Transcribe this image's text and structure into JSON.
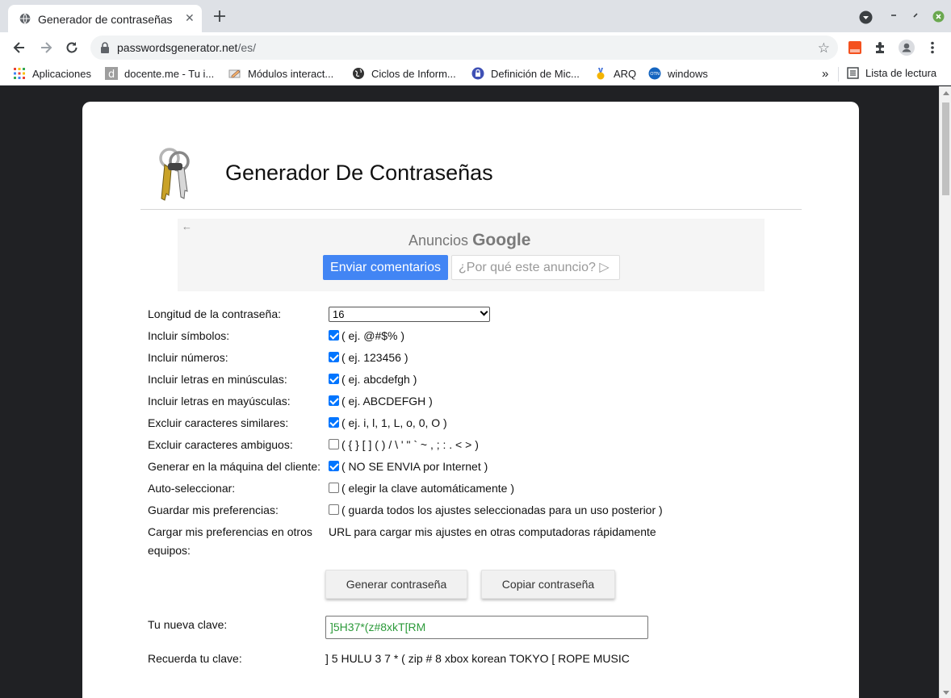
{
  "browser": {
    "tab_title": "Generador de contraseñas",
    "tab_close": "✕",
    "new_tab": "+",
    "url_host": "passwordsgenerator.net",
    "url_path": "/es/",
    "bookmarks": [
      {
        "label": "Aplicaciones",
        "icon": "apps-grid-icon"
      },
      {
        "label": "docente.me - Tu i...",
        "icon": "d-letter-icon"
      },
      {
        "label": "Módulos interact...",
        "icon": "pencil-icon"
      },
      {
        "label": "Ciclos de Inform...",
        "icon": "globe-dark-icon"
      },
      {
        "label": "Definición de Mic...",
        "icon": "lock-badge-icon"
      },
      {
        "label": "ARQ",
        "icon": "medal-icon"
      },
      {
        "label": "windows",
        "icon": "otn-icon"
      }
    ],
    "more_bookmarks": "»",
    "reading_list": "Lista de lectura"
  },
  "page": {
    "title": "Generador De Contraseñas",
    "ad": {
      "back": "←",
      "label_prefix": "Anuncios",
      "label_brand": "Google",
      "send_feedback": "Enviar comentarios",
      "why_ad": "¿Por qué este anuncio? ▷"
    },
    "form": {
      "length_label": "Longitud de la contraseña:",
      "length_value": "16",
      "rows": [
        {
          "label": "Incluir símbolos:",
          "checked": true,
          "desc": "( ej. @#$% )"
        },
        {
          "label": "Incluir números:",
          "checked": true,
          "desc": "( ej. 123456 )"
        },
        {
          "label": "Incluir letras en minúsculas:",
          "checked": true,
          "desc": "( ej. abcdefgh )"
        },
        {
          "label": "Incluir letras en mayúsculas:",
          "checked": true,
          "desc": "( ej. ABCDEFGH )"
        },
        {
          "label": "Excluir caracteres similares:",
          "checked": true,
          "desc": "( ej. i, l, 1, L, o, 0, O )"
        },
        {
          "label": "Excluir caracteres ambiguos:",
          "checked": false,
          "desc": "( { } [ ] ( ) / \\ ' \" ` ~ , ; : . < > )"
        },
        {
          "label": "Generar en la máquina del cliente:",
          "checked": true,
          "desc": "( NO SE ENVIA por Internet )"
        },
        {
          "label": "Auto-seleccionar:",
          "checked": false,
          "desc": "( elegir la clave automáticamente )"
        },
        {
          "label": "Guardar mis preferencias:",
          "checked": false,
          "desc": "( guarda todos los ajustes seleccionadas para un uso posterior )"
        }
      ],
      "load_prefs_label_1": "Cargar mis preferencias en otros",
      "load_prefs_label_2": "equipos:",
      "load_prefs_desc": "URL para cargar mis ajustes en otras computadoras rápidamente",
      "generate_button": "Generar contraseña",
      "copy_button": "Copiar contraseña",
      "new_password_label": "Tu nueva clave:",
      "new_password_value": "]5H37*(z#8xkT[RM",
      "remember_label": "Recuerda tu clave:",
      "remember_value": "] 5 HULU 3 7 * ( zip # 8 xbox korean TOKYO [ ROPE MUSIC"
    }
  },
  "colors": {
    "accent_blue": "#4285f4",
    "checkbox_blue": "#0075ff",
    "password_green": "#2c9a3a",
    "page_bg": "#202124"
  }
}
